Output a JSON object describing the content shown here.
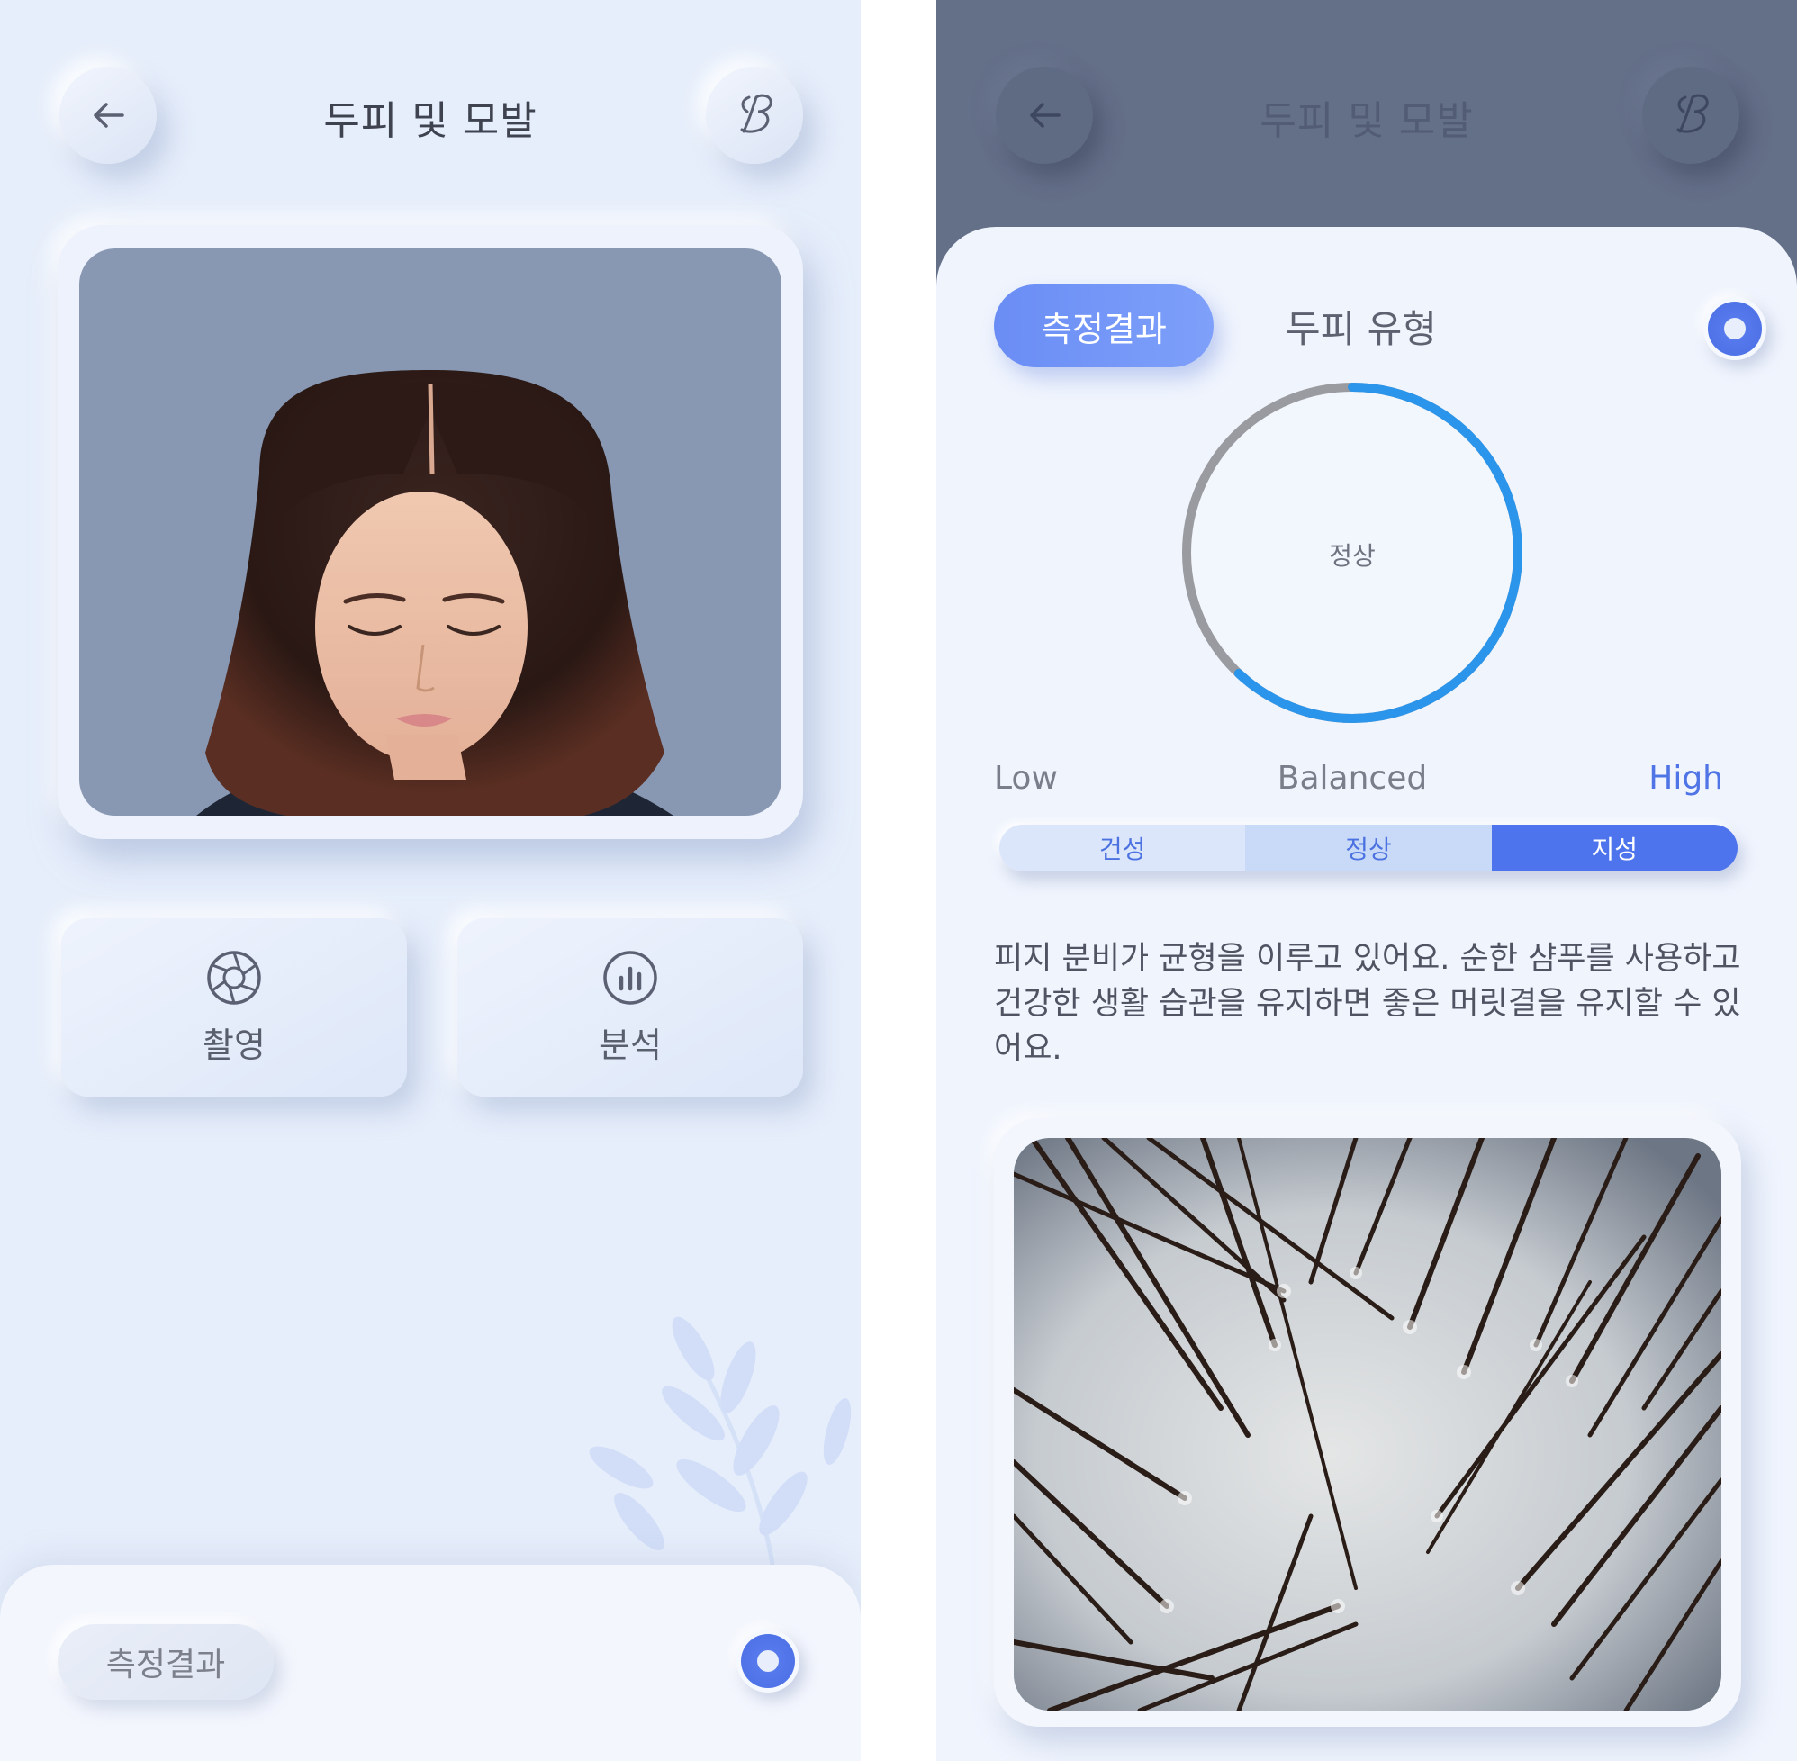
{
  "left_screen": {
    "header": {
      "title": "두피 및 모발",
      "back_icon": "arrow-left-icon",
      "brand_icon": "script-b-logo"
    },
    "actions": [
      {
        "label": "촬영",
        "icon": "aperture-icon"
      },
      {
        "label": "분석",
        "icon": "bar-chart-icon"
      }
    ],
    "bottom_sheet": {
      "pill_label": "측정결과"
    }
  },
  "right_screen": {
    "header": {
      "title": "두피 및 모발",
      "back_icon": "arrow-left-icon",
      "brand_icon": "script-b-logo"
    },
    "tabs": [
      {
        "label": "측정결과",
        "active": true
      },
      {
        "label": "두피 유형",
        "active": false
      }
    ],
    "gauge": {
      "center_label": "정상",
      "fill_fraction": 0.62
    },
    "scale": {
      "low": "Low",
      "mid": "Balanced",
      "high": "High"
    },
    "segments": [
      {
        "label": "건성",
        "active": false
      },
      {
        "label": "정상",
        "active": false
      },
      {
        "label": "지성",
        "active": true
      }
    ],
    "description": "피지 분비가 균형을 이루고 있어요. 순한 샴푸를 사용하고 건강한 생활 습관을 유지하면 좋은 머릿결을 유지할 수 있어요."
  },
  "colors": {
    "accent": "#4a6ee4",
    "gauge_blue": "#2a95ea",
    "gauge_gray": "#9a9ba0",
    "background": "#e6eefb",
    "overlay": "#646f88"
  }
}
